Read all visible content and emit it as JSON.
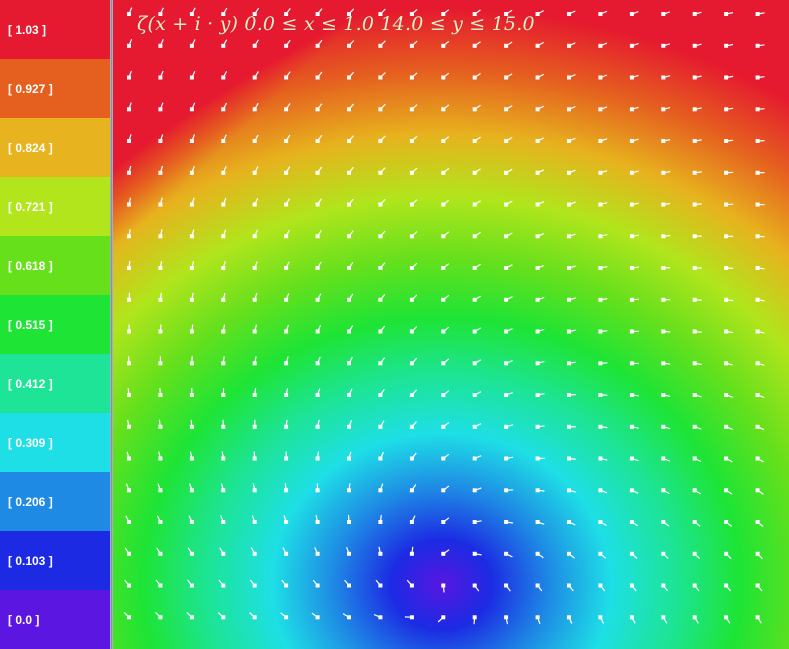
{
  "legend": {
    "items": [
      {
        "label": "[ 1.03 ]",
        "color": "#e5192f"
      },
      {
        "label": "[ 0.927 ]",
        "color": "#e5601f"
      },
      {
        "label": "[ 0.824 ]",
        "color": "#e7b31e"
      },
      {
        "label": "[ 0.721 ]",
        "color": "#b2e51c"
      },
      {
        "label": "[ 0.618 ]",
        "color": "#67e01c"
      },
      {
        "label": "[ 0.515 ]",
        "color": "#1ee436"
      },
      {
        "label": "[ 0.412 ]",
        "color": "#1de496"
      },
      {
        "label": "[ 0.309 ]",
        "color": "#1edfe6"
      },
      {
        "label": "[ 0.206 ]",
        "color": "#1e8ae4"
      },
      {
        "label": "[ 0.103 ]",
        "color": "#1c2be3"
      },
      {
        "label": "[ 0.0 ]",
        "color": "#5b16e1"
      }
    ]
  },
  "plot": {
    "title": "ζ(x + i · y)    0.0 ≤ x ≤ 1.0    14.0 ≤ y ≤ 15.0",
    "arrow_color": "#ffffff",
    "field": {
      "description_value_range": [
        0.0,
        1.03
      ],
      "minimum_location_fraction": [
        0.5,
        0.1
      ],
      "grid_columns": 21,
      "grid_rows": 20
    }
  }
}
